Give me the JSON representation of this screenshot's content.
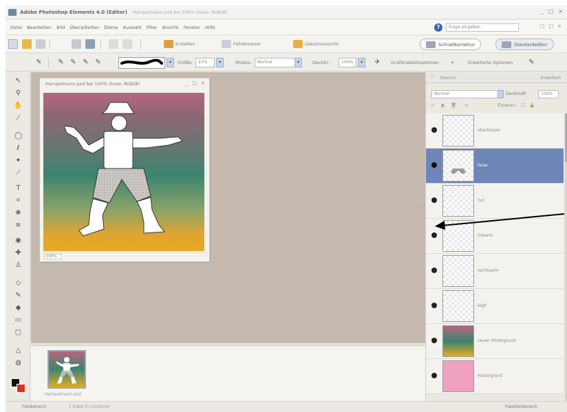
{
  "titlebar": {
    "app_title": "Adobe Photoshop Elements 4.0 (Editor)",
    "doc_title": "Hampelmann.psd bei 100% (hose, RGB/8)",
    "controls": [
      "_",
      "□",
      "×"
    ]
  },
  "menubar": {
    "items": [
      "Datei",
      "Bearbeiten",
      "Bild",
      "Überarbeiten",
      "Ebene",
      "Auswahl",
      "Filter",
      "Ansicht",
      "Fenster",
      "Hilfe"
    ],
    "help_search_placeholder": "Frage eingeben",
    "mdi_controls": [
      "□",
      "□",
      "×"
    ]
  },
  "shortcuts": {
    "create_label": "Erstellen",
    "photobrowser_label": "Fotobrowser",
    "dateview_label": "Datumsansicht",
    "quick_fix_label": "Schnellkorrektur",
    "standard_edit_label": "Standardeditor"
  },
  "optionsbar": {
    "size_label": "Größe:",
    "size_value": "9 Px",
    "mode_label": "Modus:",
    "mode_value": "Normal",
    "opacity_label": "Deckkr.:",
    "opacity_value": "100%",
    "tablet_label": "Grafiktablettoptionen",
    "more_label": "Erweiterte Optionen"
  },
  "document": {
    "title": "Hampelmann.psd bei 100% (hose, RGB/8)",
    "zoom": "100%",
    "controls": [
      "_",
      "□",
      "×"
    ]
  },
  "bin": {
    "filename": "Hampelmann.psd"
  },
  "statusbar": {
    "left": "Fotobereich",
    "middle": "1 Datei in Container",
    "right": "Palettenbereich"
  },
  "layers_palette": {
    "title": "Ebenen",
    "more": "Erweitert",
    "blend_mode": "Normal",
    "opacity_label": "Deckkraft:",
    "opacity_value": "100%",
    "lock_label": "Fixieren:",
    "layers": [
      {
        "name": "oberkörper",
        "selected": false,
        "thumb": "transparent"
      },
      {
        "name": "hose",
        "selected": true,
        "thumb": "transparent"
      },
      {
        "name": "hut",
        "selected": false,
        "thumb": "transparent"
      },
      {
        "name": "linkarm",
        "selected": false,
        "thumb": "transparent"
      },
      {
        "name": "rechtsarm",
        "selected": false,
        "thumb": "transparent"
      },
      {
        "name": "kopf",
        "selected": false,
        "thumb": "transparent"
      },
      {
        "name": "neuer Hintergrund",
        "selected": false,
        "thumb": "gradient"
      },
      {
        "name": "Hintergrund",
        "selected": false,
        "thumb": "pink"
      }
    ]
  },
  "colors": {
    "selected_layer": "#6f86b8",
    "foreground": "#111111",
    "background": "#e0301a",
    "workspace": "#c5b8ae",
    "pink_layer": "#f0a0c0"
  }
}
